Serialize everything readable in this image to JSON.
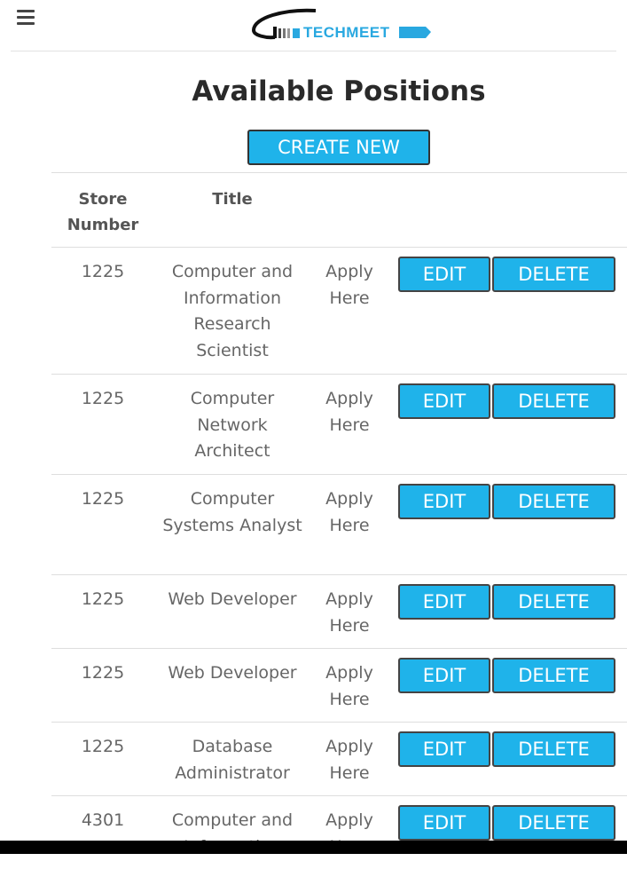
{
  "header": {
    "logo_text": "TECHMEET"
  },
  "page": {
    "title": "Available Positions",
    "create_label": "CREATE NEW"
  },
  "table": {
    "columns": [
      "Store Number",
      "Title"
    ],
    "rows": [
      {
        "store": "1225",
        "title": "Computer and Information Research Scientist",
        "apply": "Apply Here",
        "edit": "EDIT",
        "delete": "DELETE"
      },
      {
        "store": "1225",
        "title": "Computer Network Architect",
        "apply": "Apply Here",
        "edit": "EDIT",
        "delete": "DELETE"
      },
      {
        "store": "1225",
        "title": "Computer Systems Analyst",
        "apply": "Apply Here",
        "edit": "EDIT",
        "delete": "DELETE"
      },
      {
        "store": "1225",
        "title": "Web Developer",
        "apply": "Apply Here",
        "edit": "EDIT",
        "delete": "DELETE"
      },
      {
        "store": "1225",
        "title": "Web Developer",
        "apply": "Apply Here",
        "edit": "EDIT",
        "delete": "DELETE"
      },
      {
        "store": "1225",
        "title": "Database Administrator",
        "apply": "Apply Here",
        "edit": "EDIT",
        "delete": "DELETE"
      },
      {
        "store": "4301",
        "title": "Computer and Information",
        "apply": "Apply Here",
        "edit": "EDIT",
        "delete": "DELETE"
      }
    ]
  },
  "colors": {
    "accent": "#1fb3ea",
    "logo": "#29a8e0"
  },
  "icons": {
    "menu": "hamburger-menu-icon",
    "logo": "techmeet-logo-icon"
  }
}
